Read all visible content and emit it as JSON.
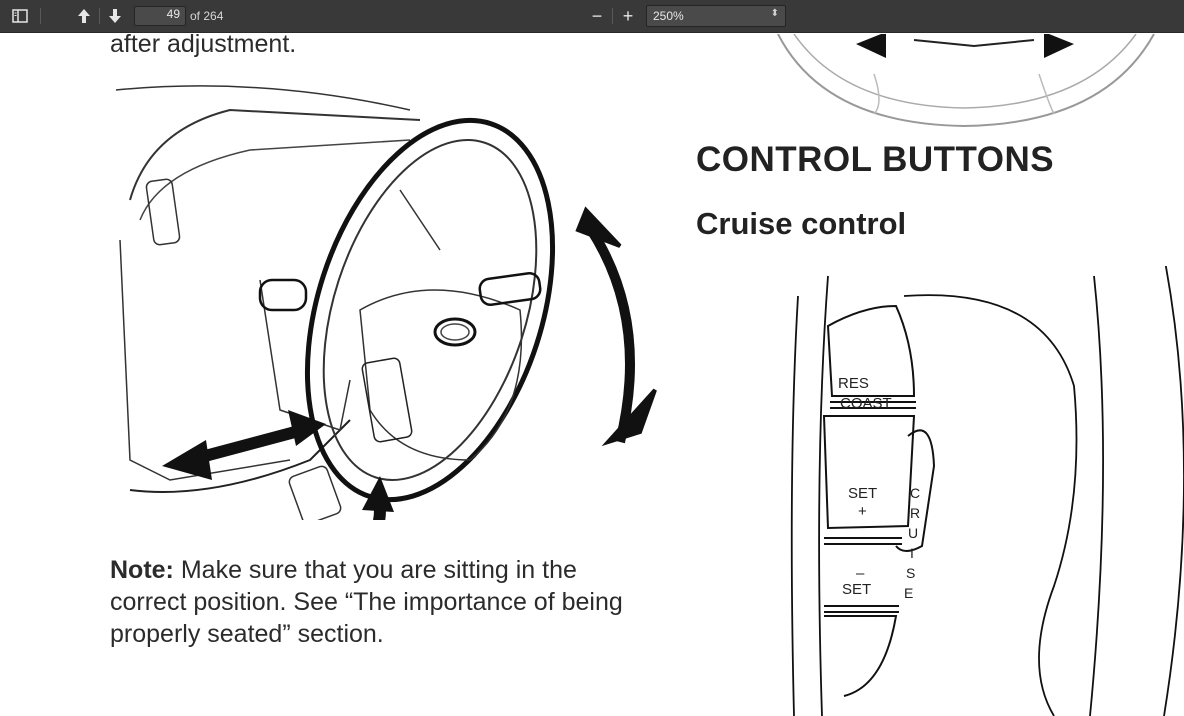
{
  "toolbar": {
    "sidebar_toggle_icon": "sidebar-toggle-icon",
    "prev_icon": "arrow-up-icon",
    "next_icon": "arrow-down-icon",
    "page_number": "49",
    "page_of": "of 264",
    "zoom_out_label": "−",
    "zoom_in_label": "+",
    "zoom_value": "250%"
  },
  "document": {
    "top_text": "after adjustment.",
    "heading": "CONTROL BUTTONS",
    "subheading": "Cruise control",
    "note_label": "Note:",
    "note_text": " Make sure that you are sitting in the correct position. See “The importance of being properly seated” section.",
    "cruise_buttons": {
      "res": "RES",
      "coast": "COAST",
      "set_plus_1": "SET",
      "set_plus_2": "+",
      "set_minus_1": "–",
      "set_minus_2": "SET",
      "cruise": [
        "C",
        "R",
        "U",
        "I",
        "S",
        "E"
      ]
    }
  }
}
